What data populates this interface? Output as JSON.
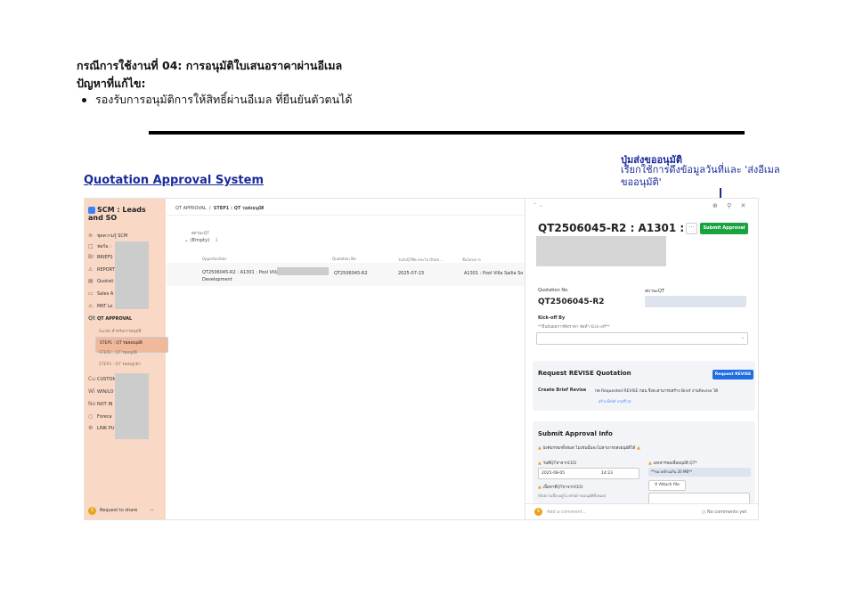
{
  "doc": {
    "heading1": "กรณีการใช้งานที่ 04: การอนุมัติใบเสนอราคาผ่านอีเมล",
    "heading2": "ปัญหาที่แก้ไข:",
    "bullet": "รองรับการอนุมัติการให้สิทธิ์ผ่านอีเมล ที่ยืนยันตัวตนได้",
    "section_title": "Quotation Approval System",
    "callout_title": "ปุ่มส่งขออนุมัติ",
    "callout_body": "เรียกใช้การดึงข้อมูลวันที่และ 'ส่งอีเมลขออนุมัติ'"
  },
  "sidebar": {
    "workspace": "SCM : Leads and SO",
    "items": [
      {
        "icon": "≋",
        "label": "ชุดความรู้ SCM"
      },
      {
        "icon": "□",
        "label": "ฟอร์ม :"
      },
      {
        "icon": "Br",
        "label": "BRIEFS"
      },
      {
        "icon": "⚠",
        "label": "REPORT"
      },
      {
        "icon": "▤",
        "label": "Quotati"
      },
      {
        "icon": "▭",
        "label": "Sales A"
      },
      {
        "icon": "⚠",
        "label": "MKT Le"
      }
    ],
    "qt_icon": "Qt",
    "qt_label": "QT APPROVAL",
    "sub_items": [
      "Guide สำหรับการอนุมัติ",
      "STEP1 : QT รอส่งอนุมัติ",
      "STEP2 : QT รออนุมัติ",
      "STEP3 : QT รอส่งลูกค้า"
    ],
    "lower_items": [
      {
        "icon": "Cu",
        "label": "CUSTOM"
      },
      {
        "icon": "Wi",
        "label": "WIN/LO"
      },
      {
        "icon": "No",
        "label": "NOT IN"
      },
      {
        "icon": "○",
        "label": "Foreca"
      },
      {
        "icon": "⚙",
        "label": "LINK PU"
      }
    ],
    "share": "Request to share",
    "avatar": "S"
  },
  "main": {
    "breadcrumb1": "QT APPROVAL",
    "breadcrumb2": "STEP1 : QT รอส่งอนุมัติ",
    "group_field": "สถานะQT",
    "group_value": "(Empty)",
    "group_count": "1",
    "columns": [
      "Opportunities",
      "Quotation No.",
      "วันรับQTที่ควรจะไป (from ...",
      "ชื่อโครงการ"
    ],
    "row": {
      "opportunity": "QT2506045-R2 : A1301 : Pool Villa S",
      "opportunity2": "Development",
      "quotation": "QT2506045-R2",
      "date": "2025-07-23",
      "project": "A1301 : Pool Villa Sailia So"
    }
  },
  "panel": {
    "title": "QT2506045-R2 : A1301 :",
    "submit_label": "Submit Approval",
    "more": "···",
    "quotation_label": "Quotation No.",
    "quotation_value": "QT2506045-R2",
    "status_label": "สถานะQT",
    "kickoff_label": "Kick-off By",
    "kickoff_hint": "**ยืนยันผลการคิดราคา จัดทำ Kick-off**",
    "revise_title": "Request REVISE Quotation",
    "revise_button": "Request REVISE",
    "create_brief": "Create Brief Revise",
    "create_brief_hint": "กด Requested REVISE ก่อน จึงจะสามารถสร้าง Brief งานRevise ได้",
    "create_brief_link": "สร้าง Brief งานรีไวส",
    "approval_title": "Submit Approval Info",
    "approval_warning": "บังคับกรอกทั้งหมด ไม่เช่นนั้นจะไม่สามารถส่งอนุมัติได้",
    "date_label": "วันที่QTหาจากCEO",
    "date_value": "2025-08-05",
    "time_value": "14:23",
    "doc_label": "เอกสารขอเพื่ออนุมัติ QT*",
    "doc_hint": "**ขนาดห้ามเกิน 20 MB**",
    "attach": "Attach file",
    "reason_label": "เนื้อหาที่QTหาจากCEO",
    "reason_hint": "(ข้อความนี้จะอยู่ใน email ขออนุมัติทั้งหมด)",
    "comment_placeholder": "Add a comment...",
    "no_comments": "No comments yet"
  }
}
